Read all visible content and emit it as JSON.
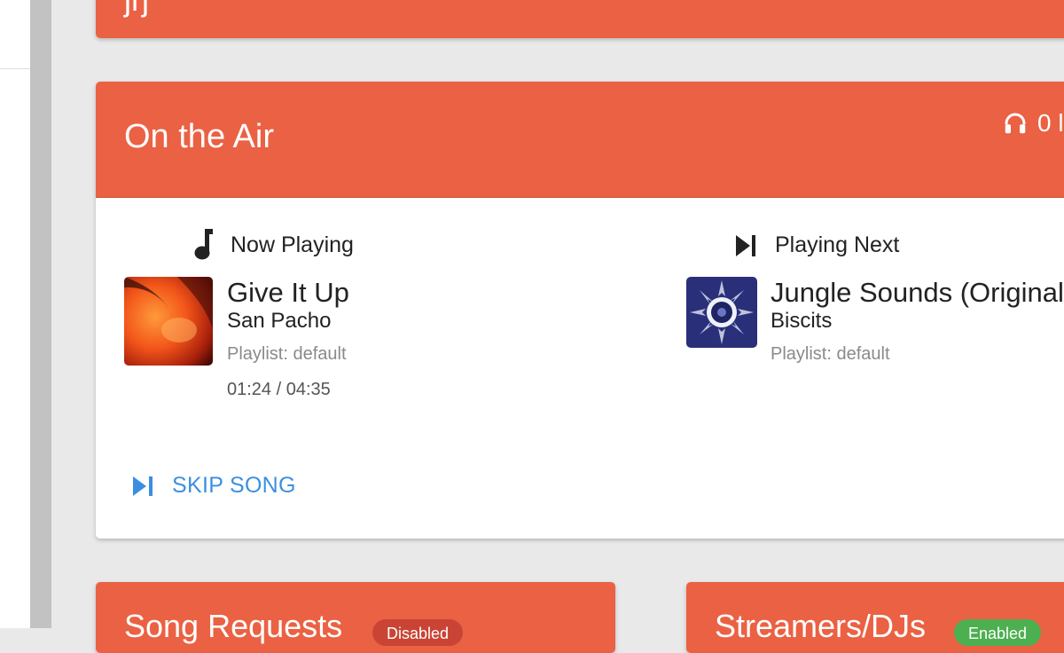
{
  "colors": {
    "accent": "#eb6143",
    "link": "#3c8fe0",
    "badge_disabled": "#c94434",
    "badge_enabled": "#4caf50"
  },
  "top_card": {
    "clipped_title": "jrj"
  },
  "on_air": {
    "title": "On the Air",
    "listeners": {
      "icon": "headphones-icon",
      "count": "0 l"
    },
    "now_playing": {
      "heading": "Now Playing",
      "icon": "music-note-icon",
      "title": "Give It Up",
      "artist": "San Pacho",
      "playlist": "Playlist: default",
      "elapsed_total": "01:24 / 04:35"
    },
    "playing_next": {
      "heading": "Playing Next",
      "icon": "skip-next-icon",
      "title": "Jungle Sounds (Original",
      "artist": "Biscits",
      "playlist": "Playlist: default"
    },
    "skip_button": "SKIP SONG"
  },
  "song_requests": {
    "title": "Song Requests",
    "badge": "Disabled"
  },
  "streamers": {
    "title": "Streamers/DJs",
    "badge": "Enabled"
  }
}
